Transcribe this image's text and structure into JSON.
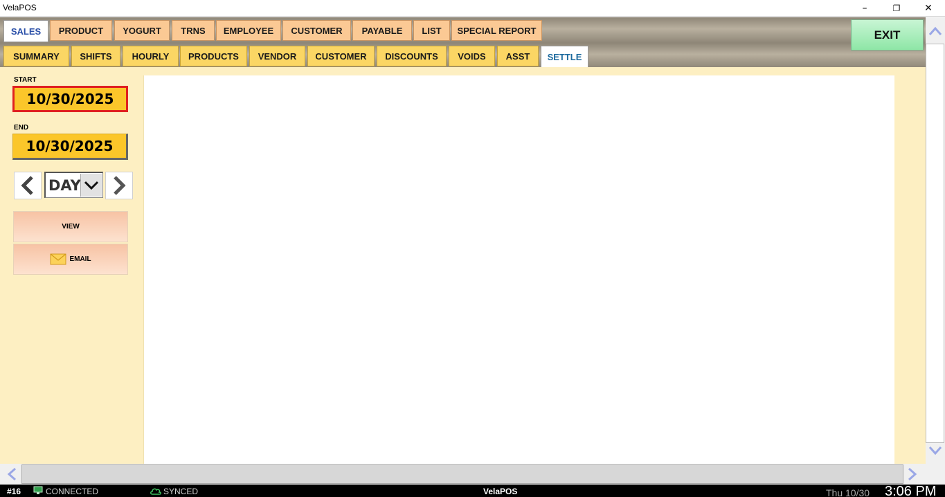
{
  "window": {
    "title": "VelaPOS",
    "minimize": "–",
    "maximize": "❐",
    "close": "✕"
  },
  "main_tabs": [
    {
      "label": "SALES",
      "active": true
    },
    {
      "label": "PRODUCT",
      "active": false
    },
    {
      "label": "YOGURT",
      "active": false
    },
    {
      "label": "TRNS",
      "active": false
    },
    {
      "label": "EMPLOYEE",
      "active": false
    },
    {
      "label": "CUSTOMER",
      "active": false
    },
    {
      "label": "PAYABLE",
      "active": false
    },
    {
      "label": "LIST",
      "active": false
    },
    {
      "label": "SPECIAL REPORT",
      "active": false
    }
  ],
  "sub_tabs": [
    {
      "label": "SUMMARY",
      "active": false
    },
    {
      "label": "SHIFTS",
      "active": false
    },
    {
      "label": "HOURLY",
      "active": false
    },
    {
      "label": "PRODUCTS",
      "active": false
    },
    {
      "label": "VENDOR",
      "active": false
    },
    {
      "label": "CUSTOMER",
      "active": false
    },
    {
      "label": "DISCOUNTS",
      "active": false
    },
    {
      "label": "VOIDS",
      "active": false
    },
    {
      "label": "ASST",
      "active": false
    },
    {
      "label": "SETTLE",
      "active": true
    }
  ],
  "exit_label": "EXIT",
  "filters": {
    "start_label": "START",
    "start_date": "10/30/2025",
    "end_label": "END",
    "end_date": "10/30/2025",
    "period": "DAY"
  },
  "actions": {
    "view_label": "VIEW",
    "email_label": "EMAIL"
  },
  "status": {
    "terminal": "#16",
    "connection": "CONNECTED",
    "sync": "SYNCED",
    "app_name": "VelaPOS",
    "date": "Thu 10/30",
    "time": "3:06 PM"
  },
  "colors": {
    "main_tab": "#fbc994",
    "sub_tab": "#fbd664",
    "panel_bg": "#fdefc2",
    "date_box": "#fbc62a",
    "start_border": "#e02020",
    "exit_button": "#8ee6a6"
  }
}
